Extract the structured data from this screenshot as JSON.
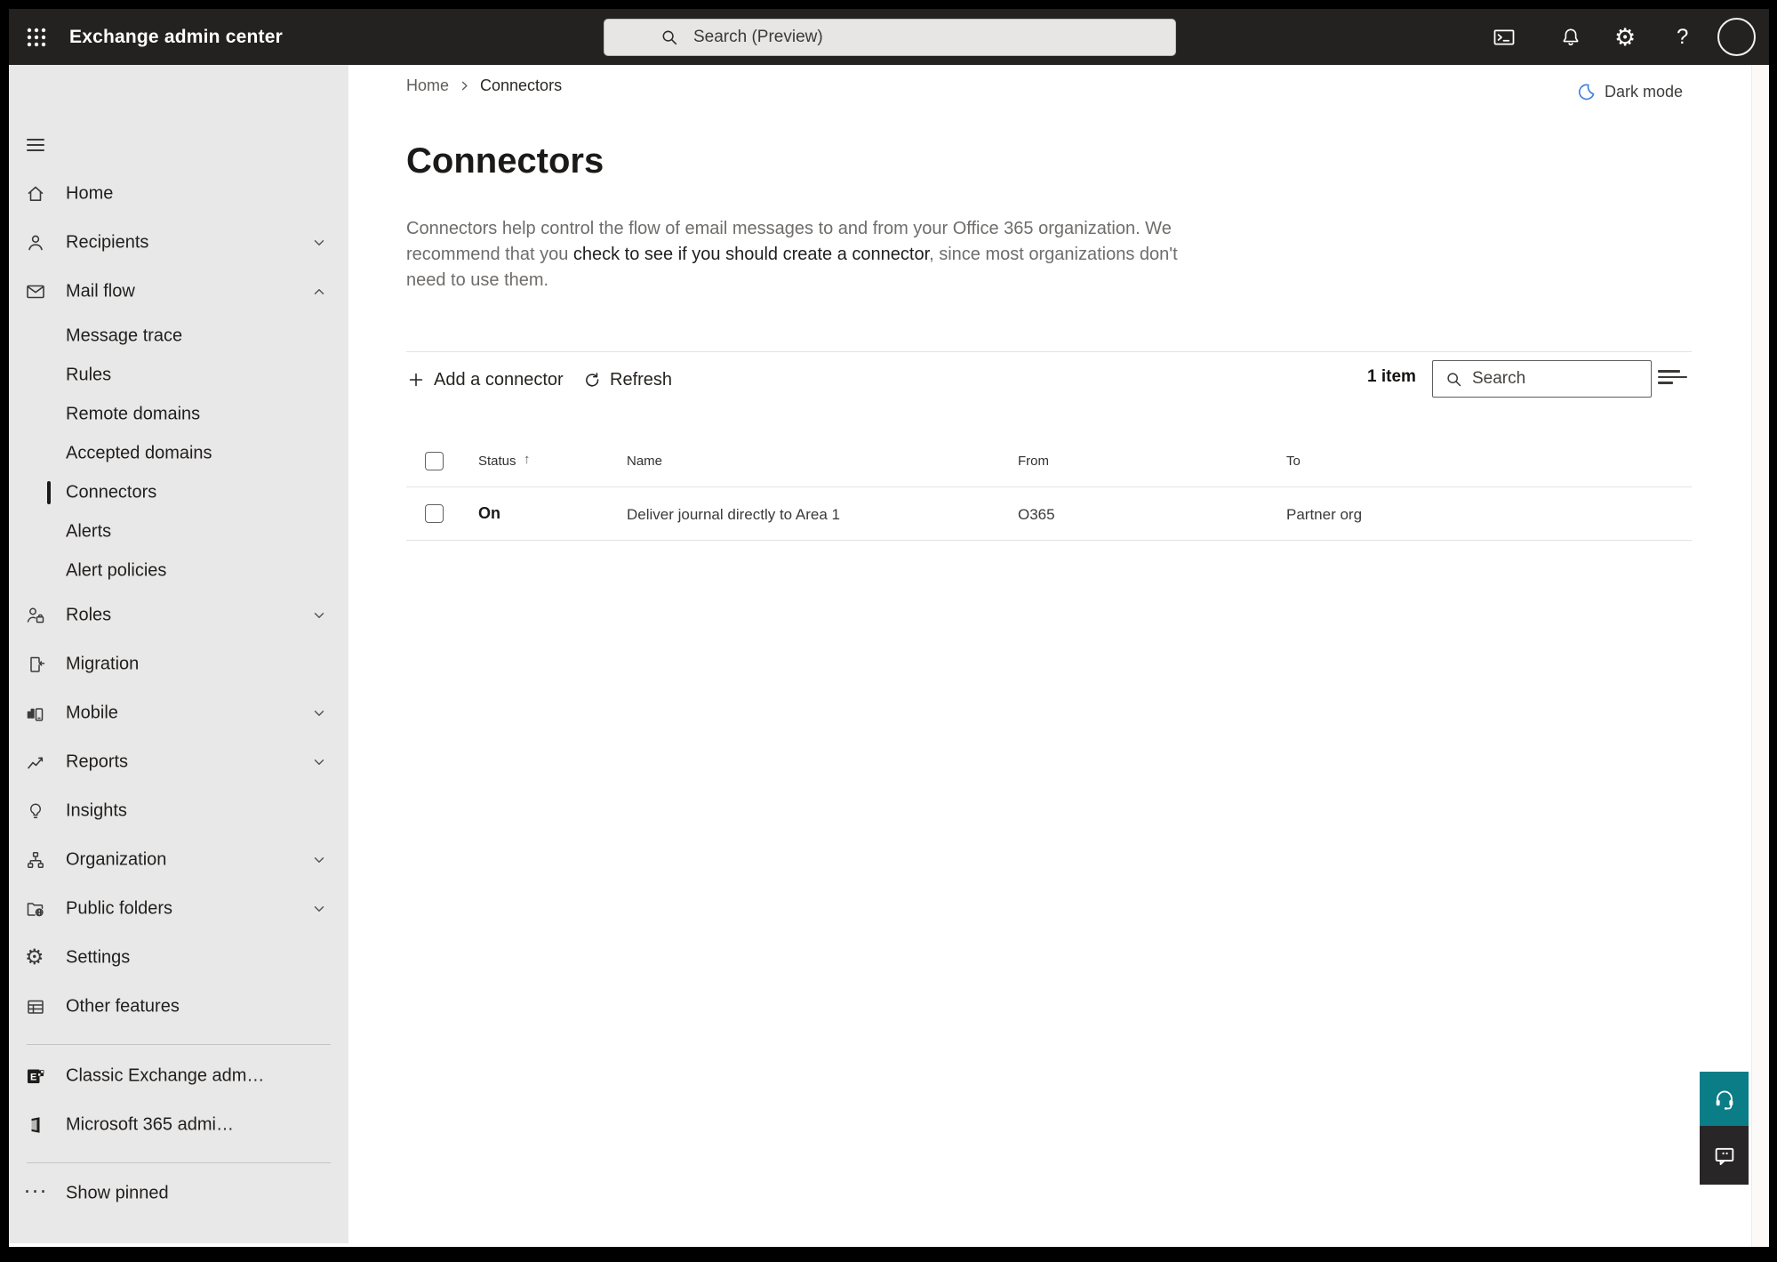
{
  "topbar": {
    "app_title": "Exchange admin center",
    "search_placeholder": "Search (Preview)",
    "icons": {
      "app_launcher": "waffle-grid",
      "cloud_shell": "terminal-window",
      "notifications": "bell",
      "settings": "gear",
      "help": "question-mark",
      "account": "avatar-circle"
    },
    "help_glyph": "?"
  },
  "sidebar": {
    "items": [
      {
        "label": "Home",
        "icon": "home-icon"
      },
      {
        "label": "Recipients",
        "icon": "person-icon",
        "chevron": "down"
      },
      {
        "label": "Mail flow",
        "icon": "mail-icon",
        "chevron": "up",
        "expanded": true
      },
      {
        "label": "Message trace",
        "sub": true
      },
      {
        "label": "Rules",
        "sub": true
      },
      {
        "label": "Remote domains",
        "sub": true
      },
      {
        "label": "Accepted domains",
        "sub": true
      },
      {
        "label": "Connectors",
        "sub": true,
        "selected": true
      },
      {
        "label": "Alerts",
        "sub": true
      },
      {
        "label": "Alert policies",
        "sub": true
      },
      {
        "label": "Roles",
        "icon": "roles-icon",
        "chevron": "down"
      },
      {
        "label": "Migration",
        "icon": "migration-icon"
      },
      {
        "label": "Mobile",
        "icon": "mobile-icon",
        "chevron": "down"
      },
      {
        "label": "Reports",
        "icon": "reports-icon",
        "chevron": "down"
      },
      {
        "label": "Insights",
        "icon": "lightbulb-icon"
      },
      {
        "label": "Organization",
        "icon": "org-chart-icon",
        "chevron": "down"
      },
      {
        "label": "Public folders",
        "icon": "folder-globe-icon",
        "chevron": "down"
      },
      {
        "label": "Settings",
        "icon": "gear-icon"
      },
      {
        "label": "Other features",
        "icon": "table-icon"
      },
      {
        "label": "Classic Exchange adm…",
        "icon": "classic-exchange-logo"
      },
      {
        "label": "Microsoft 365 admi…",
        "icon": "microsoft-365-logo"
      },
      {
        "label": "Show pinned",
        "icon": "ellipsis-icon"
      }
    ],
    "settings_glyph": "⚙",
    "ellipsis_glyph": "···",
    "exchange_letter": "E"
  },
  "page": {
    "breadcrumb": {
      "home": "Home",
      "current": "Connectors"
    },
    "dark_mode_label": "Dark mode",
    "title": "Connectors",
    "description": {
      "pre": "Connectors help control the flow of email messages to and from your Office 365 organization. We recommend that you ",
      "link": "check to see if you should create a connector",
      "post": ", since most organizations don't need to use them."
    },
    "toolbar": {
      "add_label": "Add a connector",
      "refresh_label": "Refresh",
      "item_count": "1 item",
      "search_placeholder": "Search"
    },
    "table": {
      "columns": {
        "status": "Status",
        "name": "Name",
        "from": "From",
        "to": "To"
      },
      "sort": {
        "column": "Status",
        "direction": "ascending",
        "arrow": "↑"
      },
      "rows": [
        {
          "status": "On",
          "name": "Deliver journal directly to Area 1",
          "from": "O365",
          "to": "Partner org"
        }
      ]
    }
  },
  "colors": {
    "topbar_bg": "#232221",
    "sidebar_bg": "#e9e8e8",
    "accent_teal": "#0b7d87",
    "feedback_dark": "#282626",
    "moon_blue": "#3c7fd9"
  }
}
